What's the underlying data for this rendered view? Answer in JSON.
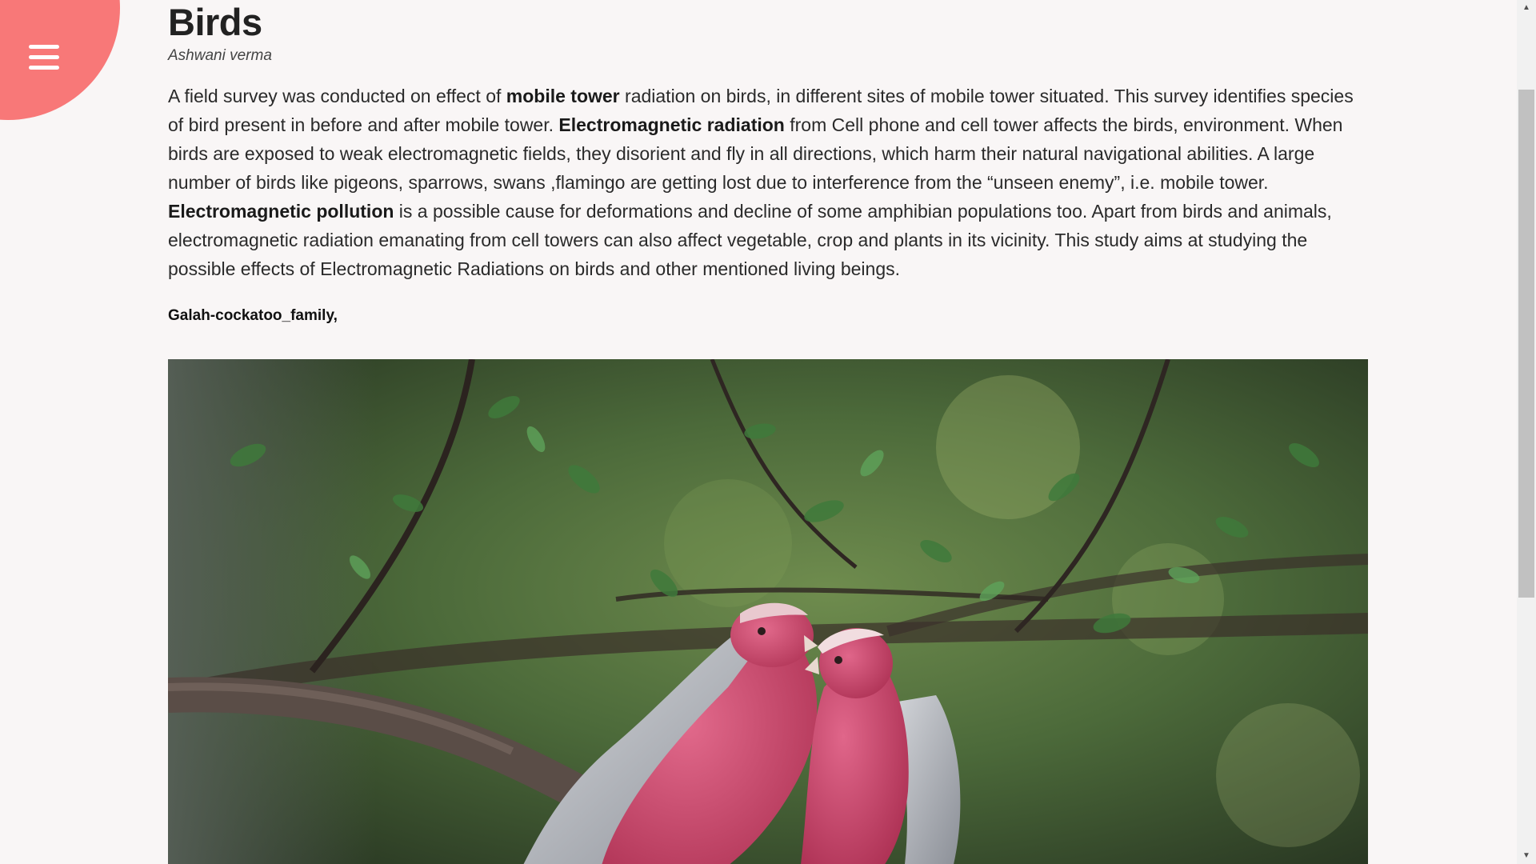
{
  "menu": {
    "icon": "hamburger-menu-icon",
    "accent_color": "#f87878"
  },
  "article": {
    "title": "Birds",
    "author": "Ashwani verma",
    "intro": {
      "p1": "A field survey was conducted on effect of ",
      "b1": "mobile tower",
      "p2": " radiation on birds, in different sites of mobile tower situated. This survey identifies species of bird present in before and after mobile tower. ",
      "b2": "Electromagnetic radiation",
      "p3": " from Cell phone and cell tower affects the birds, environment. When birds are exposed to weak electromagnetic fields, they disorient and fly in all directions, which harm their natural navigational abilities. A large number of birds like pigeons, sparrows, swans ,flamingo are getting lost due to interference from the “unseen enemy”, i.e. mobile tower. ",
      "b3": "Electromagnetic pollution",
      "p4": " is a possible cause for deformations and decline of some amphibian populations too. Apart from birds and animals, electromagnetic radiation emanating from cell towers can also affect vegetable, crop and plants in its vicinity. This study aims at studying the possible effects of Electromagnetic Radiations on birds and other mentioned living beings."
    },
    "image_caption": "Galah-cockatoo_family,"
  },
  "scrollbar": {
    "up_arrow": "▲",
    "down_arrow": "▼"
  }
}
